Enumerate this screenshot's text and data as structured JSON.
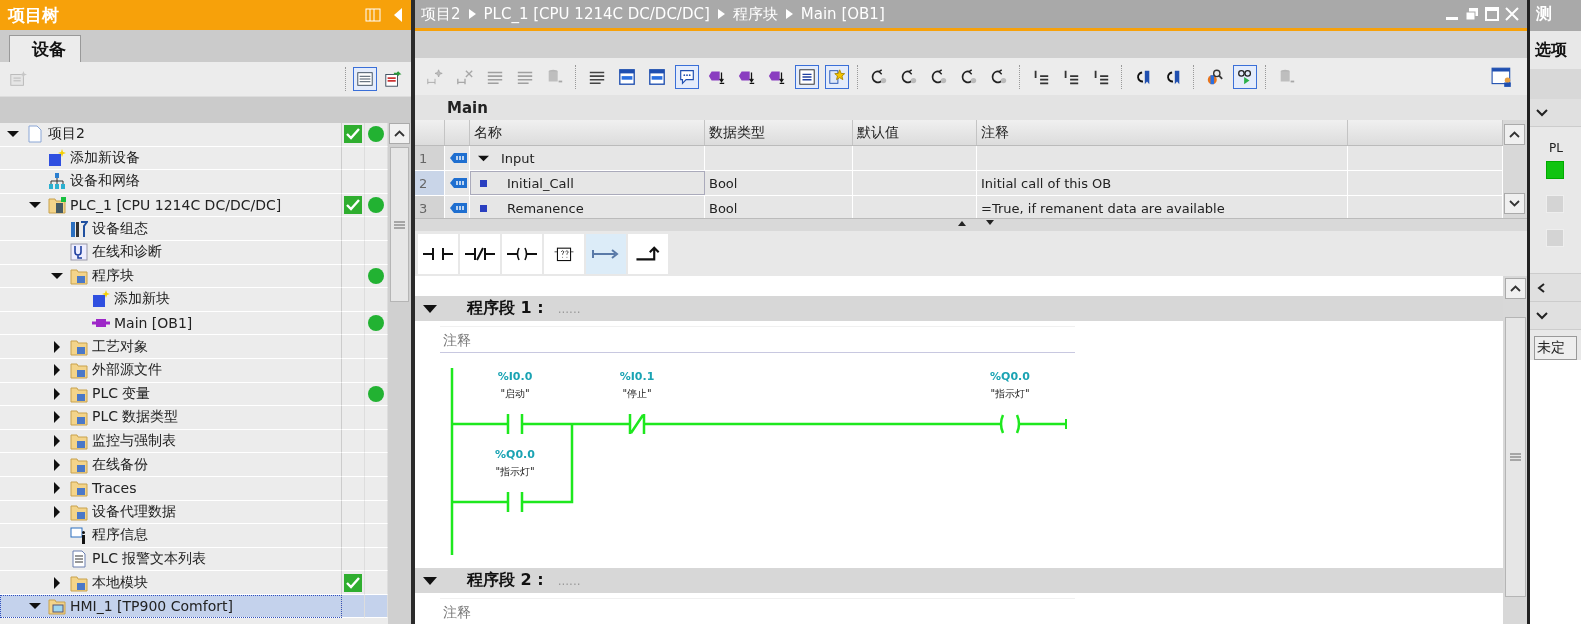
{
  "project_tree": {
    "title": "项目树",
    "tabs": [
      {
        "label": "设备",
        "selected": true
      }
    ],
    "toolbar": [
      {
        "pressed": false,
        "disabled": true
      },
      {
        "pressed": true,
        "disabled": false
      },
      {
        "pressed": false,
        "disabled": false
      }
    ],
    "items": [
      {
        "kind": "project",
        "label": "项目2",
        "expanded": true,
        "check": true,
        "dot": true,
        "selected": false,
        "children": [
          {
            "kind": "add",
            "label": "添加新设备",
            "check": false,
            "dot": false,
            "selected": false
          },
          {
            "kind": "network",
            "label": "设备和网络",
            "check": false,
            "dot": false,
            "selected": false
          },
          {
            "kind": "plc",
            "label": "PLC_1 [CPU 1214C DC/DC/DC]",
            "expanded": true,
            "check": true,
            "dot": true,
            "selected": false,
            "children": [
              {
                "kind": "config",
                "label": "设备组态",
                "check": false,
                "dot": false,
                "selected": false
              },
              {
                "kind": "diag",
                "label": "在线和诊断",
                "check": false,
                "dot": false,
                "selected": false
              },
              {
                "kind": "folder",
                "label": "程序块",
                "expanded": true,
                "check": false,
                "dot": true,
                "selected": false,
                "children": [
                  {
                    "kind": "add",
                    "label": "添加新块",
                    "check": false,
                    "dot": false,
                    "selected": false
                  },
                  {
                    "kind": "block",
                    "label": "Main [OB1]",
                    "check": false,
                    "dot": true,
                    "selected": false
                  }
                ]
              },
              {
                "kind": "folder",
                "label": "工艺对象",
                "expanded": false,
                "check": false,
                "dot": false,
                "selected": false
              },
              {
                "kind": "folder",
                "label": "外部源文件",
                "expanded": false,
                "check": false,
                "dot": false,
                "selected": false
              },
              {
                "kind": "folder",
                "label": "PLC 变量",
                "expanded": false,
                "check": false,
                "dot": true,
                "selected": false
              },
              {
                "kind": "folder",
                "label": "PLC 数据类型",
                "expanded": false,
                "check": false,
                "dot": false,
                "selected": false
              },
              {
                "kind": "folder",
                "label": "监控与强制表",
                "expanded": false,
                "check": false,
                "dot": false,
                "selected": false
              },
              {
                "kind": "folder",
                "label": "在线备份",
                "expanded": false,
                "check": false,
                "dot": false,
                "selected": false
              },
              {
                "kind": "folder",
                "label": "Traces",
                "expanded": false,
                "check": false,
                "dot": false,
                "selected": false
              },
              {
                "kind": "folder",
                "label": "设备代理数据",
                "expanded": false,
                "check": false,
                "dot": false,
                "selected": false
              },
              {
                "kind": "info",
                "label": "程序信息",
                "check": false,
                "dot": false,
                "selected": false
              },
              {
                "kind": "textlist",
                "label": "PLC 报警文本列表",
                "check": false,
                "dot": false,
                "selected": false
              },
              {
                "kind": "folder",
                "label": "本地模块",
                "expanded": false,
                "check": true,
                "dot": false,
                "selected": false
              }
            ]
          },
          {
            "kind": "hmi",
            "label": "HMI_1 [TP900 Comfort]",
            "expanded": true,
            "check": false,
            "dot": false,
            "selected": true
          }
        ]
      }
    ]
  },
  "editor": {
    "breadcrumb": [
      "项目2",
      "PLC_1 [CPU 1214C DC/DC/DC]",
      "程序块",
      "Main [OB1]"
    ],
    "toolbar": [
      {
        "pressed": false,
        "disabled": true
      },
      {
        "pressed": false,
        "disabled": true
      },
      {
        "pressed": false,
        "disabled": true
      },
      {
        "pressed": false,
        "disabled": true
      },
      {
        "pressed": false,
        "disabled": true
      },
      {
        "pressed": false,
        "disabled": false
      },
      {
        "pressed": false,
        "disabled": false
      },
      {
        "pressed": false,
        "disabled": false
      },
      {
        "pressed": true,
        "disabled": false
      },
      {
        "pressed": false,
        "disabled": false
      },
      {
        "pressed": false,
        "disabled": false
      },
      {
        "pressed": false,
        "disabled": false
      },
      {
        "pressed": true,
        "disabled": false
      },
      {
        "pressed": true,
        "disabled": false
      },
      {
        "pressed": false,
        "disabled": false
      },
      {
        "pressed": false,
        "disabled": false
      },
      {
        "pressed": false,
        "disabled": false
      },
      {
        "pressed": false,
        "disabled": false
      },
      {
        "pressed": false,
        "disabled": false
      },
      {
        "pressed": false,
        "disabled": false
      },
      {
        "pressed": false,
        "disabled": false
      },
      {
        "pressed": false,
        "disabled": false
      },
      {
        "pressed": false,
        "disabled": false
      },
      {
        "pressed": false,
        "disabled": false
      },
      {
        "pressed": false,
        "disabled": false
      },
      {
        "pressed": true,
        "disabled": false
      },
      {
        "pressed": false,
        "disabled": true
      }
    ],
    "interface": {
      "title": "Main",
      "columns": [
        "名称",
        "数据类型",
        "默认值",
        "注释"
      ],
      "rows": [
        {
          "number": "1",
          "name": "Input",
          "expanded": true,
          "selected": false
        },
        {
          "number": "2",
          "name": "Initial_Call",
          "data_type": "Bool",
          "comment": "Initial call of this OB",
          "selected": true
        },
        {
          "number": "3",
          "name": "Remanence",
          "data_type": "Bool",
          "comment": "=True, if remanent data are available",
          "selected": false
        }
      ]
    },
    "ladder_tools": [
      {
        "selected": false
      },
      {
        "selected": false
      },
      {
        "selected": false
      },
      {
        "selected": false
      },
      {
        "selected": true
      },
      {
        "selected": false
      }
    ],
    "networks": [
      {
        "title": "程序段 1 :",
        "dots": "......",
        "comment": {
          "placeholder": "注释"
        },
        "rung": [
          {
            "kind": "no_contact",
            "address": "%I0.0",
            "tag": "\"启动\""
          },
          {
            "kind": "nc_contact",
            "address": "%I0.1",
            "tag": "\"停止\""
          },
          {
            "kind": "coil",
            "address": "%Q0.0",
            "tag": "\"指示灯\""
          }
        ],
        "parallel": [
          {
            "kind": "no_contact",
            "address": "%Q0.0",
            "tag": "\"指示灯\""
          }
        ]
      },
      {
        "title": "程序段 2 :",
        "dots": "......",
        "comment": {
          "placeholder": "注释"
        }
      }
    ]
  },
  "side_panel": {
    "title": "测",
    "section": "选项",
    "label": "PL",
    "indicators": [
      {
        "on": true
      },
      {
        "on": false
      },
      {
        "on": false
      }
    ],
    "field": "未定"
  }
}
